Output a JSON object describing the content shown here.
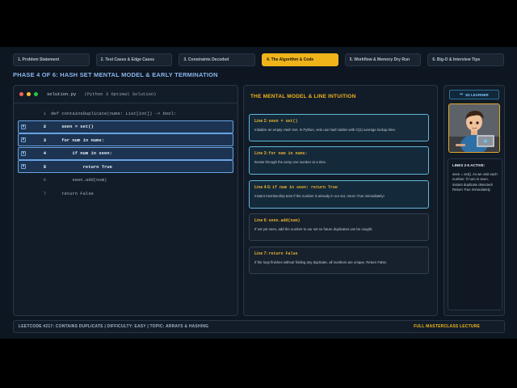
{
  "tabs": [
    {
      "label": "1. Problem Statement"
    },
    {
      "label": "2. Test Cases & Edge Cases"
    },
    {
      "label": "3. Constraints Decoded"
    },
    {
      "label": "4. The Algorithm & Code"
    },
    {
      "label": "5. Workflow & Memory Dry Run"
    },
    {
      "label": "6. Big-O & Interview Tips"
    }
  ],
  "active_tab_index": 3,
  "phase_title": "PHASE 4 OF 6:  HASH SET MENTAL MODEL & EARLY TERMINATION",
  "editor": {
    "filename": "solution.py",
    "subtitle": "(Python 3 Optimal Solution)",
    "lines": [
      {
        "num": "1",
        "code": "def containsDuplicate(nums: List[int]) -> bool:",
        "highlighted": false
      },
      {
        "num": "2",
        "code": "    seen = set()",
        "highlighted": true
      },
      {
        "num": "3",
        "code": "    for num in nums:",
        "highlighted": true
      },
      {
        "num": "4",
        "code": "        if num in seen:",
        "highlighted": true
      },
      {
        "num": "5",
        "code": "            return True",
        "highlighted": true
      },
      {
        "num": "6",
        "code": "        seen.add(num)",
        "highlighted": false
      },
      {
        "num": "7",
        "code": "    return False",
        "highlighted": false
      }
    ]
  },
  "mental_model": {
    "title": "THE MENTAL MODEL & LINE INTUITION",
    "cards": [
      {
        "prefix": "Line 2: ",
        "code": "seen = set()",
        "desc": "Initialize an empty Hash Set. In Python, sets use hash tables with O(1) average lookup time.",
        "highlighted": true
      },
      {
        "prefix": "Line 3: ",
        "code": "for num in nums:",
        "desc": "Iterate through the array one number at a time.",
        "highlighted": true
      },
      {
        "prefix": "Line 4-5: ",
        "code": "if num in seen: return True",
        "desc": "Instant membership test! If the number is already in our set, return True immediately!",
        "highlighted": true
      },
      {
        "prefix": "Line 6: ",
        "code": "seen.add(num)",
        "desc": "If not yet seen, add the number to our set so future duplicates can be caught.",
        "highlighted": false
      },
      {
        "prefix": "Line 7: ",
        "code": "return False",
        "desc": "If the loop finishes without finding any duplicate, all numbers are unique. Return False.",
        "highlighted": false
      }
    ]
  },
  "learner": {
    "badge": "3D LEARNER",
    "active_title": "LINES 2-5 ACTIVE:",
    "active_text": "seen = set(). As we visit each number: if num in seen, instant duplicate detected! Return True immediately."
  },
  "footer": {
    "left": "LEETCODE #217: CONTAINS DUPLICATE  |  DIFFICULTY: EASY  |  TOPIC: ARRAYS & HASHING",
    "right": "FULL MASTERCLASS LECTURE"
  },
  "colors": {
    "accent": "#f0b41a",
    "highlight_border": "#69a3e3",
    "background": "#0d1621"
  }
}
